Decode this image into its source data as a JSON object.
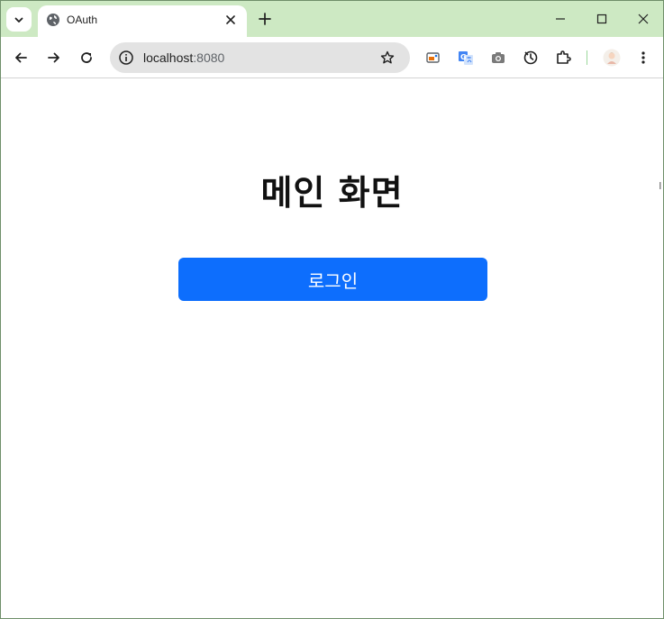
{
  "browser": {
    "tab_title": "OAuth",
    "url_host": "localhost",
    "url_port": ":8080",
    "colors": {
      "frame": "#cde9c3",
      "omnibox": "#e3e3e3"
    }
  },
  "page": {
    "heading": "메인 화면",
    "login_button": "로그인",
    "colors": {
      "button": "#0d6efd",
      "button_text": "#ffffff"
    }
  }
}
